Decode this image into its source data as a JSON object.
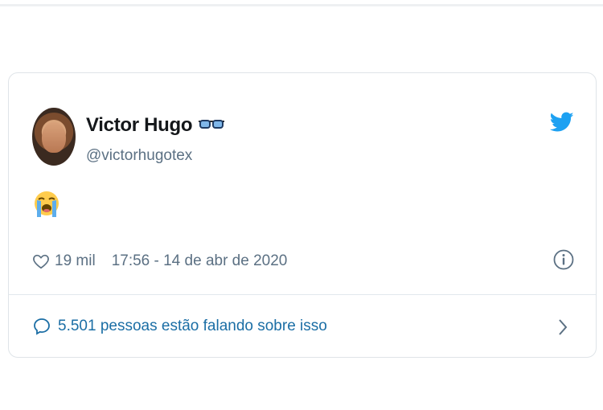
{
  "tweet": {
    "author": {
      "name": "Victor Hugo",
      "handle": "@victorhugotex",
      "name_emoji": "glasses-icon"
    },
    "body_emoji": "loudly-crying-face-emoji",
    "likes": "19 mil",
    "timestamp": "17:56 - 14 de abr de 2020",
    "conversation": "5.501 pessoas estão falando sobre isso"
  },
  "colors": {
    "twitter_blue": "#1da1f2",
    "link_blue": "#1b6ea5",
    "secondary_text": "#5b7083",
    "border": "#dfe4e8"
  }
}
